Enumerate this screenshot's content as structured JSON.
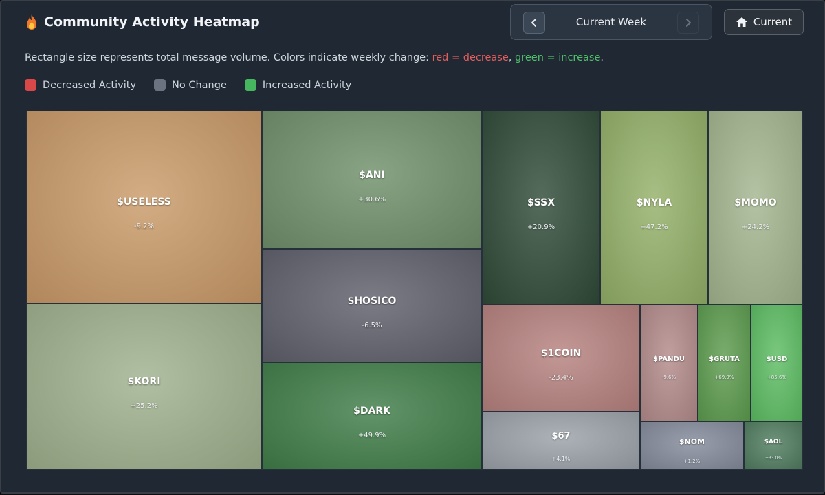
{
  "header": {
    "title": "Community Activity Heatmap",
    "title_icon": "fire-icon",
    "week_label": "Current Week",
    "prev_icon": "chevron-left-icon",
    "next_icon": "chevron-right-icon",
    "current_label": "Current",
    "current_icon": "home-icon"
  },
  "description": {
    "prefix": "Rectangle size represents total message volume. Colors indicate weekly change: ",
    "red_text": "red = decrease",
    "separator": ", ",
    "green_text": "green = increase",
    "suffix": "."
  },
  "legend": [
    {
      "label": "Decreased Activity",
      "color": "#d94848"
    },
    {
      "label": "No Change",
      "color": "#6b7280"
    },
    {
      "label": "Increased Activity",
      "color": "#46b75e"
    }
  ],
  "tiles": [
    {
      "name": "$USELESS",
      "change": "-9.2%",
      "color": "#c99a68"
    },
    {
      "name": "$ANI",
      "change": "+30.6%",
      "color": "#6f8f6a"
    },
    {
      "name": "$SSX",
      "change": "+20.9%",
      "color": "#2f4a38"
    },
    {
      "name": "$NYLA",
      "change": "+47.2%",
      "color": "#93b068"
    },
    {
      "name": "$MOMO",
      "change": "+24.2%",
      "color": "#a3b58e"
    },
    {
      "name": "$HOSICO",
      "change": "-6.5%",
      "color": "#5e5f6a"
    },
    {
      "name": "$KORI",
      "change": "+25.2%",
      "color": "#9fb08d"
    },
    {
      "name": "$DARK",
      "change": "+49.9%",
      "color": "#3f7d48"
    },
    {
      "name": "$1COIN",
      "change": "-23.4%",
      "color": "#b5817e"
    },
    {
      "name": "$PANDU",
      "change": "-9.6%",
      "color": "#b38a8a"
    },
    {
      "name": "$GRUTA",
      "change": "+69.9%",
      "color": "#5c9b4e"
    },
    {
      "name": "$USD",
      "change": "+85.6%",
      "color": "#5cbc62"
    },
    {
      "name": "$67",
      "change": "+4.1%",
      "color": "#9aa1a8"
    },
    {
      "name": "$NOM",
      "change": "+1.2%",
      "color": "#838a9a"
    },
    {
      "name": "$AOL",
      "change": "+33.0%",
      "color": "#4f7c5f"
    }
  ]
}
